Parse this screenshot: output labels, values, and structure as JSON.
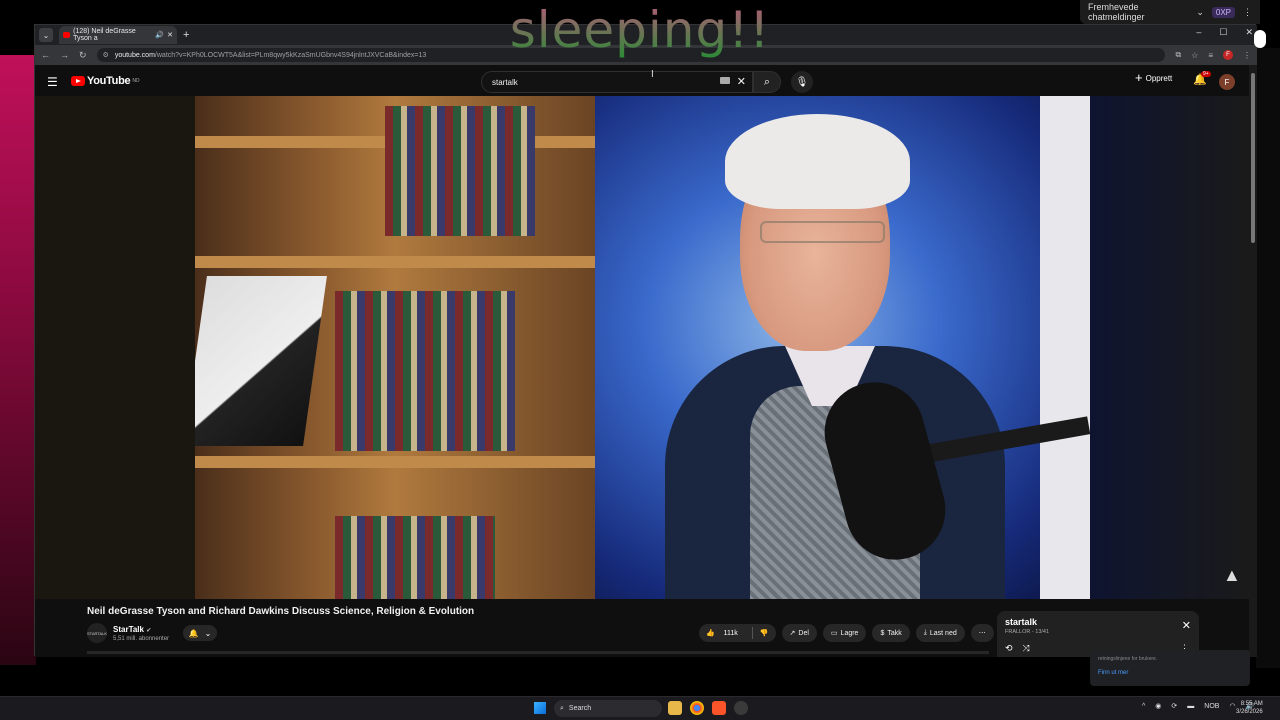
{
  "overlay": {
    "text": "sleeping!!"
  },
  "top_right": {
    "label": "Fremhevede chatmeldinger",
    "xp": "0XP"
  },
  "browser": {
    "tab_title": "(128) Neil deGrasse Tyson a",
    "url_host": "youtube.com",
    "url_path": "/watch?v=KPh0LOCWT5A&list=PLm8qwy5kKzaSmUGbnv4S94jnlntJXVCaB&index=13",
    "new_tab": "+"
  },
  "youtube": {
    "logo_text": "YouTube",
    "logo_region": "NO",
    "search_value": "startalk",
    "create_label": "Opprett",
    "notif_count": "9+",
    "avatar_letter": "F",
    "video_title": "Neil deGrasse Tyson and Richard Dawkins Discuss Science, Religion & Evolution",
    "channel": {
      "name": "StarTalk",
      "subs": "5,51 mill. abonnenter",
      "avatar_text": "STARTALK"
    },
    "actions": {
      "likes": "111k",
      "share": "Del",
      "save": "Lagre",
      "thanks": "Takk",
      "download": "Last ned"
    },
    "playlist": {
      "title": "startalk",
      "subtitle": "FRALLOR - 13/41"
    }
  },
  "notification": {
    "text": "retningslinjene for brukere.",
    "link": "Finn ut mer"
  },
  "taskbar": {
    "search": "Search",
    "lang": "NOB",
    "time": "8:55 AM",
    "date": "3/26/2026"
  }
}
